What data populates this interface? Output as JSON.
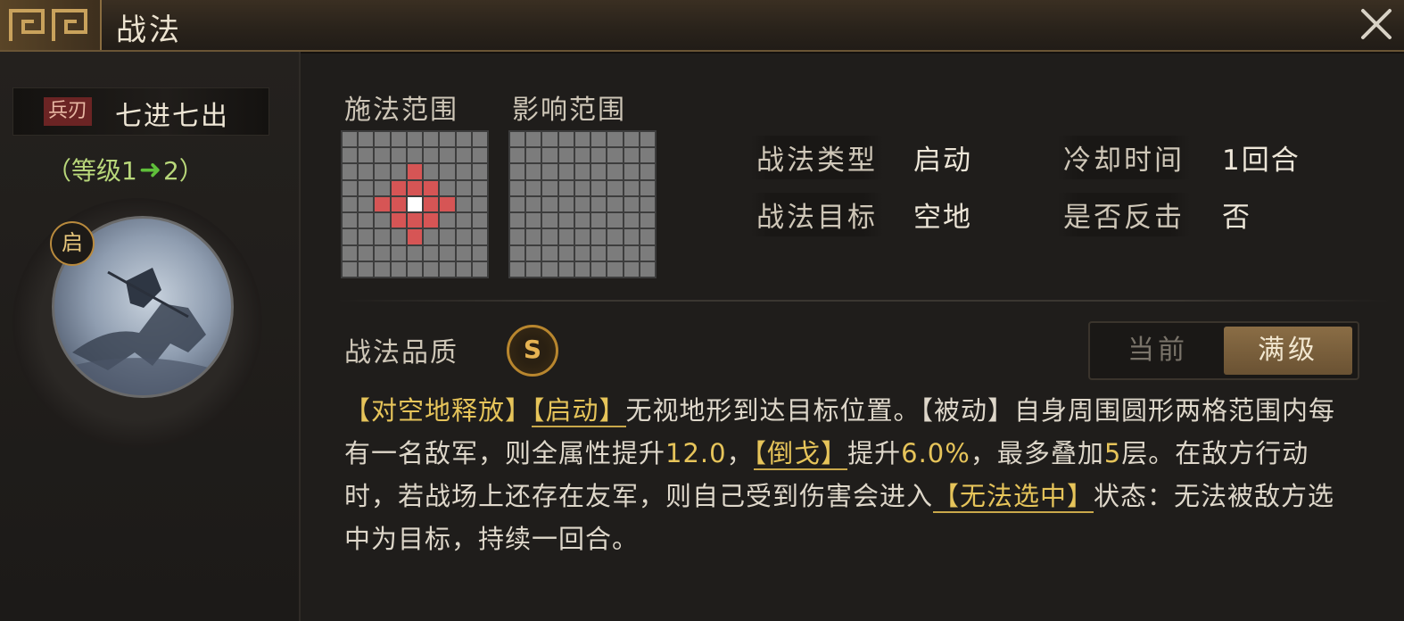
{
  "window": {
    "title": "战法"
  },
  "skill": {
    "weapon_tag": "兵刃",
    "name": "七进七出",
    "level_prefix": "（等级1",
    "level_to": "2）",
    "trigger_badge": "启"
  },
  "ranges": {
    "cast_label": "施法范围",
    "effect_label": "影响范围"
  },
  "info": {
    "type_label": "战法类型",
    "type_value": "启动",
    "cooldown_label": "冷却时间",
    "cooldown_value": "1回合",
    "target_label": "战法目标",
    "target_value": "空地",
    "counter_label": "是否反击",
    "counter_value": "否"
  },
  "quality": {
    "label": "战法品质",
    "grade": "S"
  },
  "toggle": {
    "current": "当前",
    "max": "满级"
  },
  "description": {
    "p1": "【对空地释放】",
    "p2": "【启动】",
    "p3": "无视地形到达目标位置。【被动】自身周围圆形两格范围内每有一名敌军，则全属性提升",
    "n1": "12.0",
    "p4": "，",
    "p5": "【倒戈】",
    "p6": "提升",
    "n2": "6.0%",
    "p7": "，最多叠加",
    "n3": "5",
    "p8": "层。在敌方行动时，若战场上还存在友军，则自己受到伤害会进入",
    "p9": "【无法选中】",
    "p10": "状态：无法被敌方选中为目标，持续一回合。"
  },
  "colors": {
    "accent": "#e6c45a",
    "level": "#b8d77a",
    "grade": "#e6b352"
  },
  "icons": {
    "close": "close-icon",
    "arrow": "arrow-right-icon",
    "ornament": "fret-ornament-icon"
  }
}
